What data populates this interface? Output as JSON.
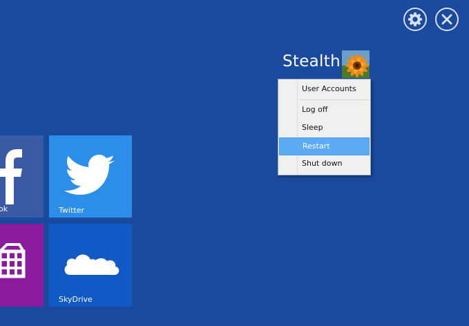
{
  "user": {
    "name": "Stealth",
    "avatar_icon": "orange-flower-photo"
  },
  "top_bar": {
    "settings_icon": "gear-icon",
    "close_icon": "close-icon"
  },
  "user_menu": {
    "items": [
      {
        "label": "User Accounts",
        "highlighted": false
      },
      {
        "label": "Log off",
        "highlighted": false
      },
      {
        "label": "Sleep",
        "highlighted": false
      },
      {
        "label": "Restart",
        "highlighted": true
      },
      {
        "label": "Shut down",
        "highlighted": false
      }
    ]
  },
  "tiles": {
    "facebook": {
      "label": "ok",
      "icon": "facebook-icon",
      "color": "#3b5aa6"
    },
    "twitter": {
      "label": "Twitter",
      "icon": "twitter-bird-icon",
      "color": "#2b8ee8"
    },
    "store": {
      "label": "",
      "icon": "store-bag-icon",
      "color": "#8b1a9c"
    },
    "skydrive": {
      "label": "SkyDrive",
      "icon": "cloud-icon",
      "color": "#1159c4"
    }
  },
  "colors": {
    "background": "#1a4a9e",
    "menu_highlight": "#5aaaf5"
  }
}
